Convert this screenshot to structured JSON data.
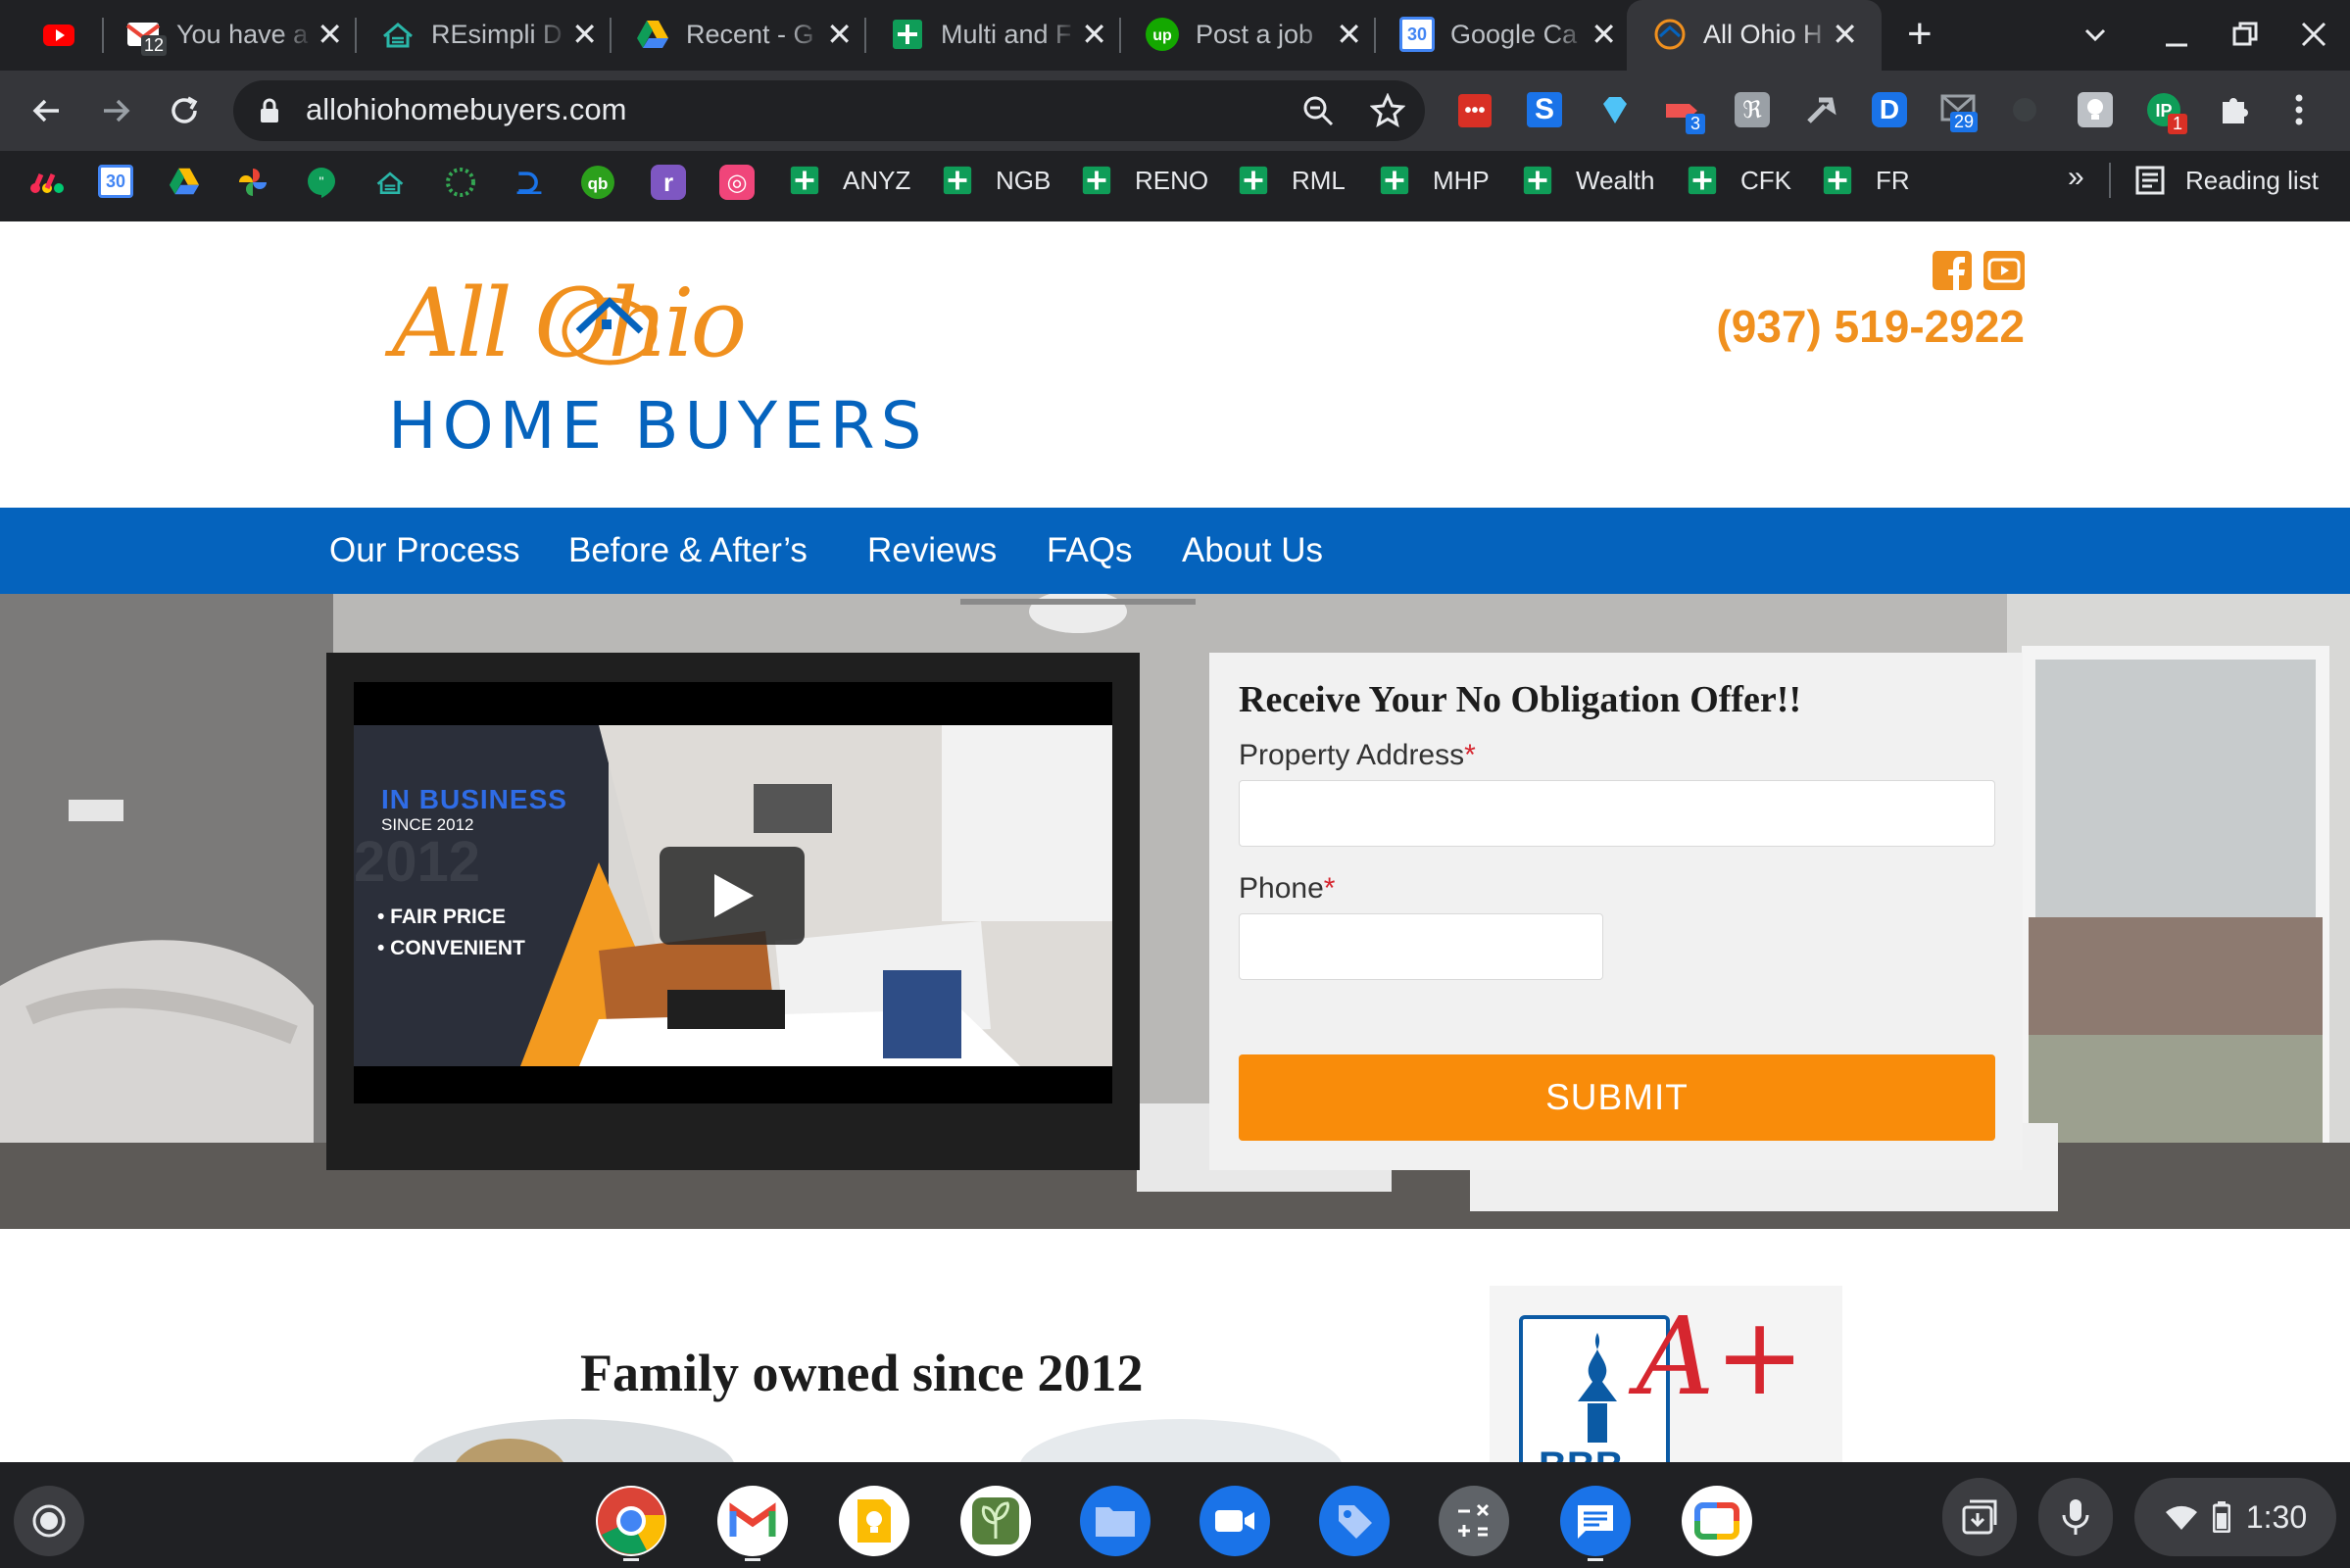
{
  "browser": {
    "tabs": [
      {
        "title": ""
      },
      {
        "title": "You have a",
        "badge": "12"
      },
      {
        "title": "REsimpli D"
      },
      {
        "title": "Recent - G"
      },
      {
        "title": "Multi and F"
      },
      {
        "title": "Post a job"
      },
      {
        "title": "Google Ca",
        "badge": "30"
      },
      {
        "title": "All Ohio H"
      }
    ],
    "new_tab": "+",
    "url": "allohiohomebuyers.com",
    "extension_badges": {
      "three": "3",
      "twentynine": "29",
      "one": "1"
    },
    "bookmarks": {
      "calendar_badge": "30",
      "items": [
        "ANYZ",
        "NGB",
        "RENO",
        "RML",
        "MHP",
        "Wealth",
        "CFK",
        "FR"
      ],
      "overflow": "»",
      "reading_list": "Reading list"
    }
  },
  "site": {
    "logo": {
      "script": "All Ohio",
      "name": "HOME BUYERS"
    },
    "phone": "(937) 519-2922",
    "nav": [
      "Our Process",
      "Before & After’s",
      "Reviews",
      "FAQs",
      "About Us"
    ],
    "video": {
      "headline": "IN BUSINESS",
      "since": "SINCE 2012",
      "year_ghost": "2012",
      "bullets": [
        "• FAIR PRICE",
        "• CONVENIENT"
      ]
    },
    "form": {
      "title": "Receive Your No Obligation Offer!!",
      "address_label": "Property Address",
      "phone_label": "Phone",
      "required_mark": "*",
      "submit": "SUBMIT"
    },
    "family_heading": "Family owned since 2012",
    "bbb": {
      "grade": "A+",
      "letters": "BBB"
    }
  },
  "shelf": {
    "time": "1:30"
  },
  "colors": {
    "brand_blue": "#0563bd",
    "brand_orange": "#f98c0a",
    "phone_orange": "#f0901e"
  }
}
